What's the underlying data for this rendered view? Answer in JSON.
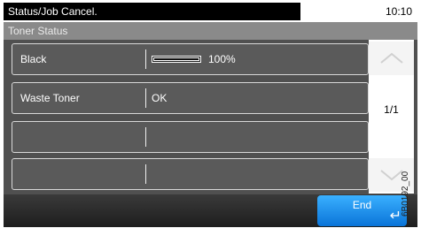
{
  "header": {
    "title": "Status/Job Cancel.",
    "time": "10:10"
  },
  "section": {
    "title": "Toner Status"
  },
  "rows": [
    {
      "label": "Black",
      "value": "100%",
      "level": 1.0
    },
    {
      "label": "Waste Toner",
      "value": "OK"
    },
    {
      "label": "",
      "value": ""
    },
    {
      "label": "",
      "value": ""
    }
  ],
  "pagination": {
    "page": "1/1"
  },
  "footer": {
    "end_label": "End"
  },
  "side_code": "6B0192_00",
  "icons": {
    "up": "chevron-up-icon",
    "down": "chevron-down-icon",
    "enter": "enter-icon"
  },
  "colors": {
    "accent": "#1b8cf0",
    "panel": "#505050",
    "subheader": "#8a8a8a"
  }
}
